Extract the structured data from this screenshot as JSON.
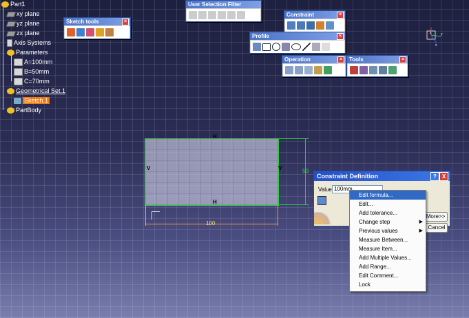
{
  "tree": {
    "root": "Part1",
    "items": [
      {
        "label": "xy plane",
        "type": "plane"
      },
      {
        "label": "yz plane",
        "type": "plane"
      },
      {
        "label": "zx plane",
        "type": "plane"
      },
      {
        "label": "Axis Systems",
        "type": "axis"
      },
      {
        "label": "Parameters",
        "type": "param-group"
      },
      {
        "label": "A=100mm",
        "type": "param"
      },
      {
        "label": "B=50mm",
        "type": "param"
      },
      {
        "label": "C=70mm",
        "type": "param"
      },
      {
        "label": "Geometrical Set.1",
        "type": "geoset"
      },
      {
        "label": "Sketch.1",
        "type": "sketch"
      },
      {
        "label": "PartBody",
        "type": "body"
      }
    ]
  },
  "toolbars": {
    "sketch_tools": "Sketch tools",
    "user_selection_filter": "User Selection Filter",
    "constraint": "Constraint",
    "profile": "Profile",
    "operation": "Operation",
    "tools": "Tools"
  },
  "sketch": {
    "dim_width": "100",
    "dim_height": "50",
    "label_h_top": "H",
    "label_h_bottom": "H",
    "label_v_left": "V",
    "label_v_right": "V"
  },
  "dialog": {
    "title": "Constraint Definition",
    "value_label": "Value",
    "value": "100mm",
    "more_button": "More>>",
    "cancel_button": "Cancel",
    "help": "?",
    "close": "X"
  },
  "context_menu": {
    "items": [
      {
        "label": "Edit formula...",
        "submenu": false
      },
      {
        "label": "Edit...",
        "submenu": false
      },
      {
        "label": "Add tolerance...",
        "submenu": false
      },
      {
        "label": "Change step",
        "submenu": true
      },
      {
        "label": "Previous values",
        "submenu": true
      },
      {
        "label": "Measure Between...",
        "submenu": false
      },
      {
        "label": "Measure Item...",
        "submenu": false
      },
      {
        "label": "Add Multiple Values...",
        "submenu": false
      },
      {
        "label": "Add Range...",
        "submenu": false
      },
      {
        "label": "Edit Comment...",
        "submenu": false
      },
      {
        "label": "Lock",
        "submenu": false
      }
    ]
  },
  "compass": {
    "z": "z",
    "y": "y",
    "x": "x"
  },
  "colors": {
    "highlight": "#f07a10",
    "menu_active": "#316ac5",
    "sketch_green": "#2ecc40"
  }
}
